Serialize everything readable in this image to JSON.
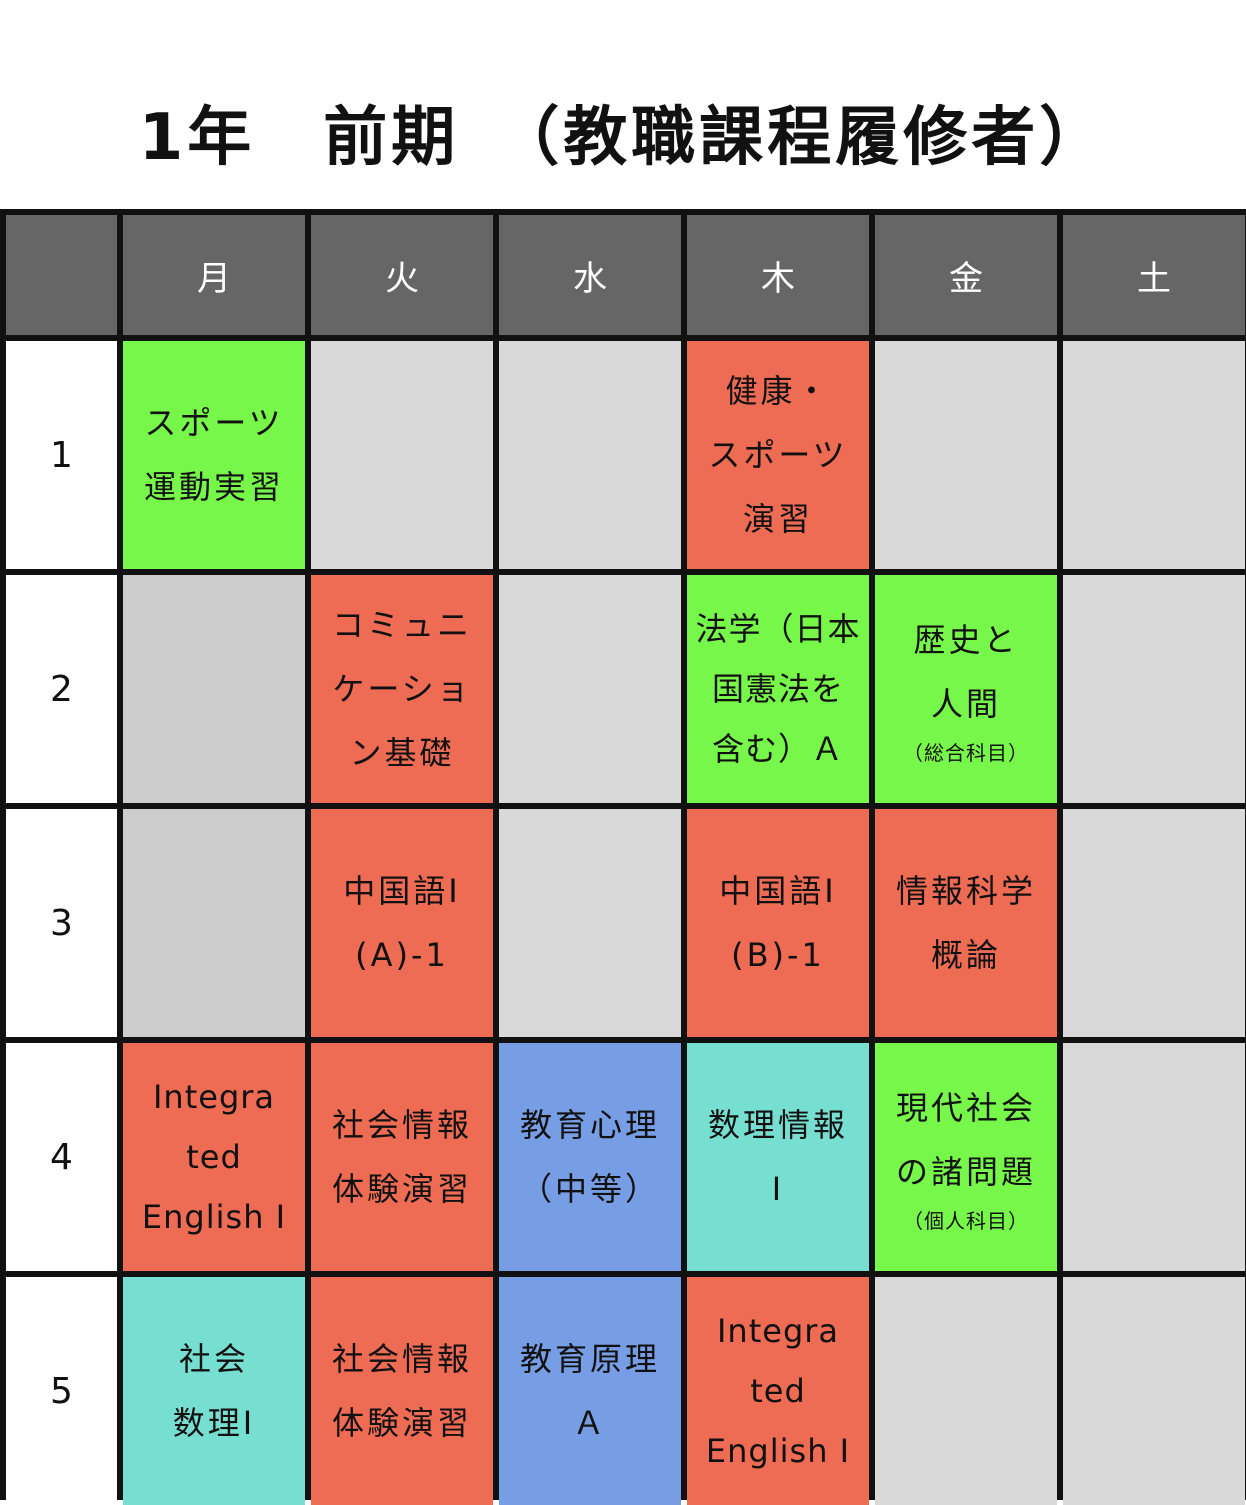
{
  "title": "1年　前期　（教職課程履修者）",
  "colors": {
    "header_bg": "#666666",
    "grid_line": "#111111",
    "required": "#ee6b54",
    "elective": "#77f74a",
    "teacher_training": "#779ee4",
    "math_info": "#77dfd1",
    "empty": "#d9d9d9"
  },
  "days": [
    "月",
    "火",
    "水",
    "木",
    "金",
    "土"
  ],
  "periods": [
    "1",
    "2",
    "3",
    "4",
    "5"
  ],
  "cells": {
    "p1": {
      "mon": [
        "スポーツ",
        "運動実習"
      ],
      "thu": [
        "健康・",
        "スポーツ",
        "演習"
      ]
    },
    "p2": {
      "tue": [
        "コミュニ",
        "ケーショ",
        "ン基礎"
      ],
      "thu": [
        "法学（日本",
        "国憲法を",
        "含む）Ａ"
      ],
      "fri": [
        "歴史と",
        "人間",
        "（総合科目）"
      ]
    },
    "p3": {
      "tue": [
        "中国語Ⅰ",
        "(A)-1"
      ],
      "thu": [
        "中国語Ⅰ",
        "(B)-1"
      ],
      "fri": [
        "情報科学",
        "概論"
      ]
    },
    "p4": {
      "mon": [
        "Integra",
        "ted",
        "English I"
      ],
      "tue": [
        "社会情報",
        "体験演習"
      ],
      "wed": [
        "教育心理",
        "（中等）"
      ],
      "thu": [
        "数理情報",
        "Ⅰ"
      ],
      "fri": [
        "現代社会",
        "の諸問題",
        "（個人科目）"
      ]
    },
    "p5": {
      "mon": [
        "社会",
        "数理Ⅰ"
      ],
      "tue": [
        "社会情報",
        "体験演習"
      ],
      "wed": [
        "教育原理",
        "Ａ"
      ],
      "thu": [
        "Integra",
        "ted",
        "English I"
      ]
    }
  }
}
